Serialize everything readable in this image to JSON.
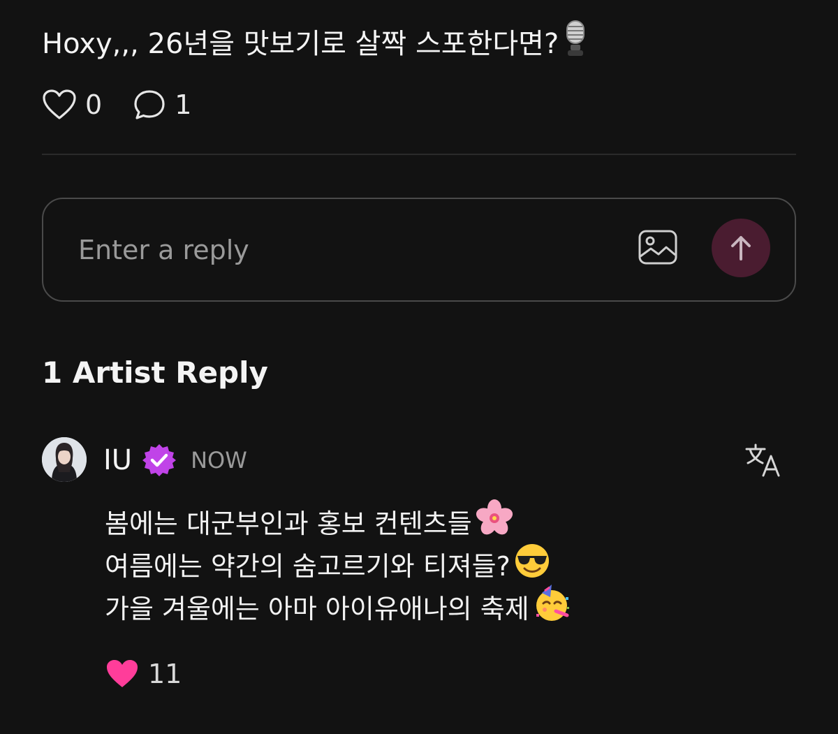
{
  "post": {
    "text": "Hoxy,,, 26년을 맛보기로 살짝 스포한다면?",
    "emoji": "microphone"
  },
  "stats": {
    "likes": "0",
    "comments": "1"
  },
  "reply_input": {
    "placeholder": "Enter a reply"
  },
  "section": {
    "title": "1 Artist Reply"
  },
  "reply": {
    "author": "IU",
    "timestamp": "NOW",
    "lines": [
      {
        "text": "봄에는 대군부인과 홍보 컨텐츠들",
        "emoji": "cherry-blossom"
      },
      {
        "text": "여름에는 약간의 숨고르기와 티져들? ",
        "emoji": "smiling-face-with-sunglasses"
      },
      {
        "text": "가을 겨울에는 아마 아이유애나의 축제 ",
        "emoji": "partying-face"
      }
    ],
    "likes": "11"
  },
  "colors": {
    "background": "#121212",
    "send_button": "#4a1c30",
    "verified_badge": "#c043e8",
    "like_heart": "#ff3d9a"
  }
}
